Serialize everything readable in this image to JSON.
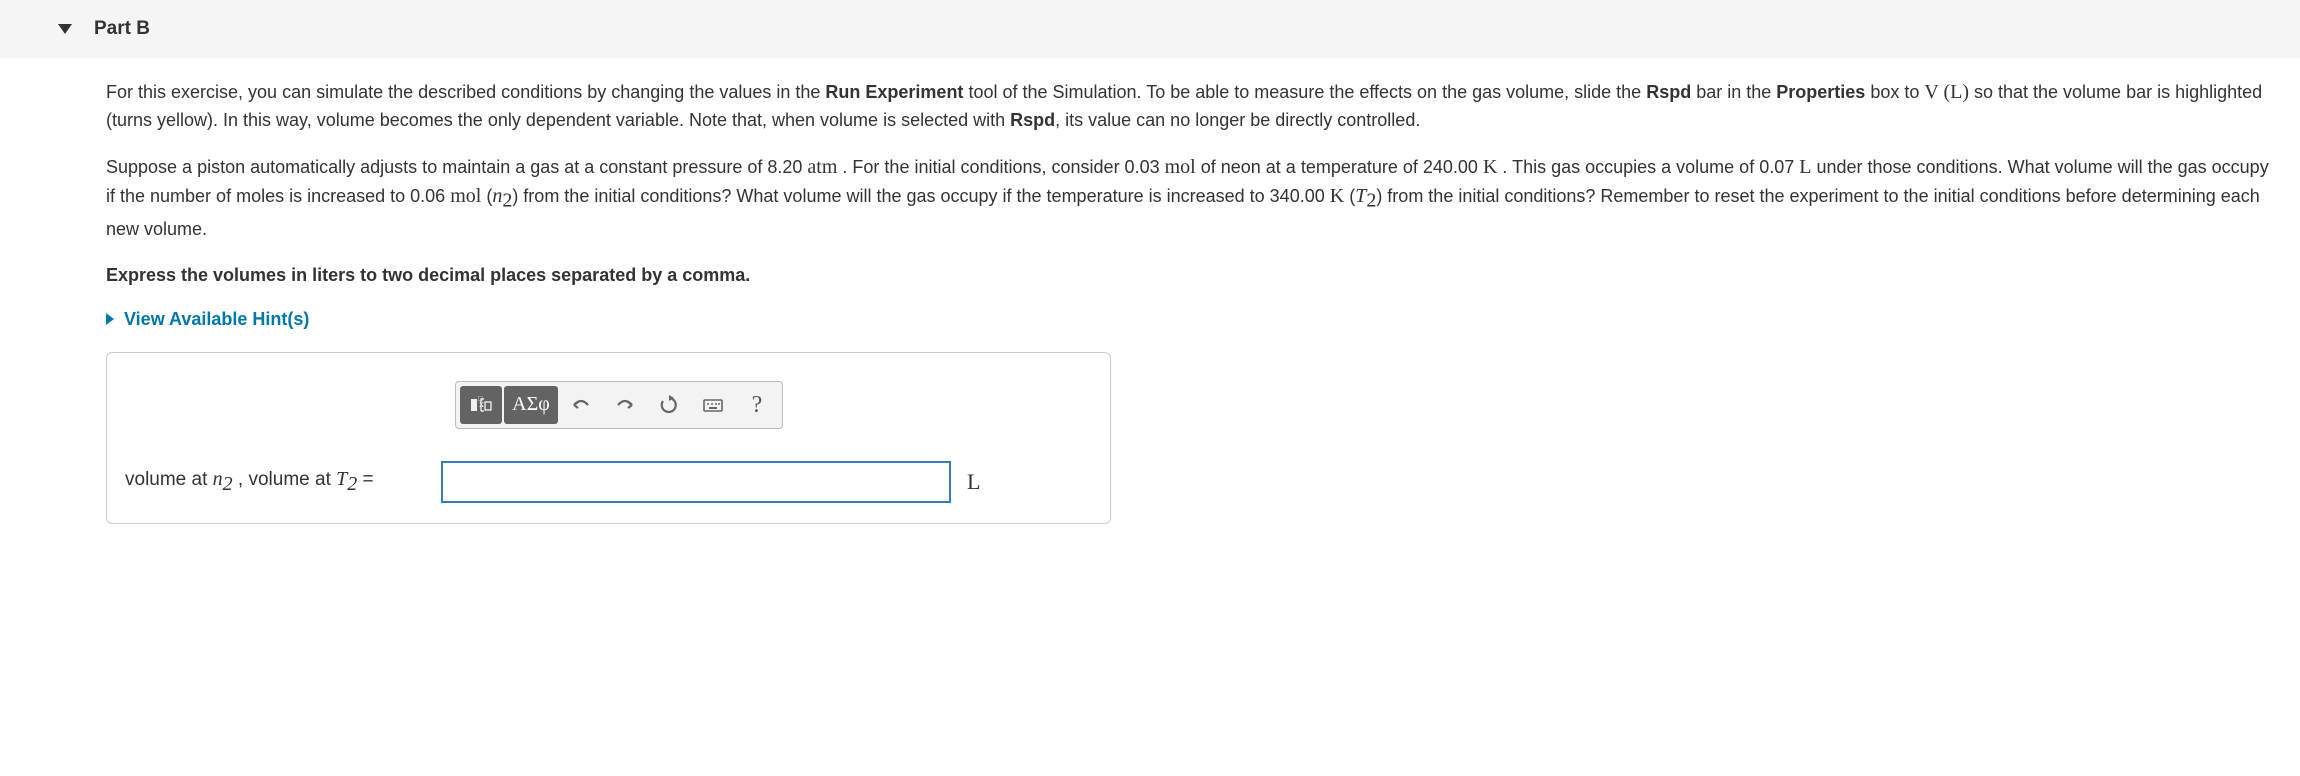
{
  "header": {
    "title": "Part B"
  },
  "paragraphs": {
    "p1_a": "For this exercise, you can simulate the described conditions by changing the values in the ",
    "p1_run_exp": "Run Experiment",
    "p1_b": " tool of the Simulation. To be able to measure the effects on the gas volume, slide the ",
    "p1_rspd": "Rspd",
    "p1_c": " bar in the ",
    "p1_props": "Properties",
    "p1_d": " box to ",
    "p1_vl": "V (L)",
    "p1_e": " so that the volume bar is highlighted (turns yellow). In this way, volume becomes the only dependent variable. Note that, when volume is selected with ",
    "p1_rspd2": "Rspd",
    "p1_f": ", its value can no longer be directly controlled.",
    "p2_a": "Suppose a piston automatically adjusts to maintain a gas at a constant pressure of 8.20 ",
    "p2_atm": "atm",
    "p2_b": " . For the initial conditions, consider  0.03 ",
    "p2_mol1": "mol",
    "p2_c": " of neon at a temperature of 240.00 ",
    "p2_k1": "K",
    "p2_d": " . This gas occupies a volume of 0.07 ",
    "p2_L": "L",
    "p2_e": " under those conditions. What volume will the gas occupy if the number of moles is increased to 0.06 ",
    "p2_mol2": "mol",
    "p2_f": " (",
    "p2_n2": "n",
    "p2_n2sub": "2",
    "p2_g": ") from the initial conditions? What volume will the gas occupy if the temperature is increased to 340.00 ",
    "p2_k2": "K",
    "p2_h": " (",
    "p2_T2": "T",
    "p2_T2sub": "2",
    "p2_i": ") from the initial conditions? Remember to reset the experiment to the initial conditions before determining each new volume."
  },
  "instruction": "Express the volumes in liters to two decimal places separated by a comma.",
  "hints": {
    "label": "View Available Hint(s)"
  },
  "toolbar": {
    "special": "ΑΣφ",
    "help": "?"
  },
  "answer": {
    "label_pre": "volume at ",
    "label_n": "n",
    "label_n_sub": "2",
    "label_mid": " , volume at ",
    "label_T": "T",
    "label_T_sub": "2",
    "label_eq": " =",
    "value": "",
    "unit": "L"
  }
}
